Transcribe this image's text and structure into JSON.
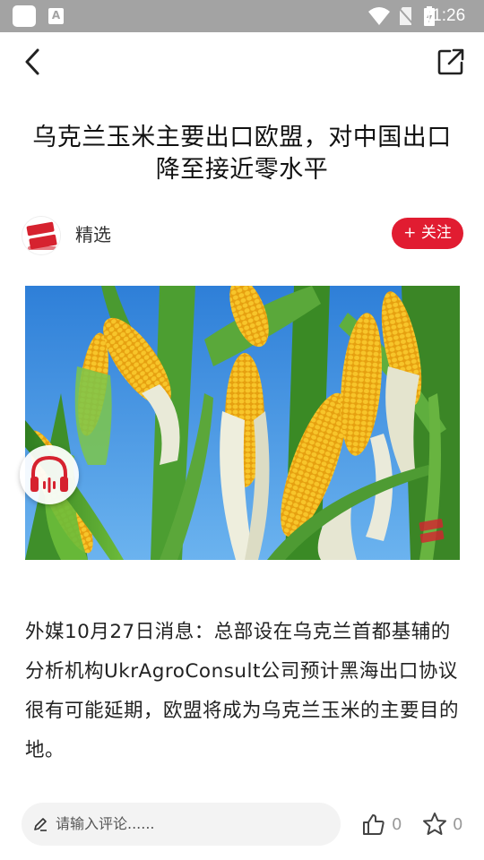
{
  "status_bar": {
    "notification_icon": "a-notification-icon",
    "time": "11:26"
  },
  "nav": {
    "back_icon": "chevron-left-icon",
    "share_icon": "share-external-icon"
  },
  "article": {
    "title": "乌克兰玉米主要出口欧盟，对中国出口降至接近零水平",
    "source_name": "精选",
    "follow_label": "+ 关注",
    "body": "外媒10月27日消息：总部设在乌克兰首都基辅的分析机构UkrAgroConsult公司预计黑海出口协议很有可能延期，欧盟将成为乌克兰玉米的主要目的地。"
  },
  "bottom_bar": {
    "comment_placeholder": "请输入评论......",
    "like_count": "0",
    "favorite_count": "0"
  },
  "colors": {
    "accent": "#e11c31",
    "status_bar": "#a3a3a3"
  }
}
